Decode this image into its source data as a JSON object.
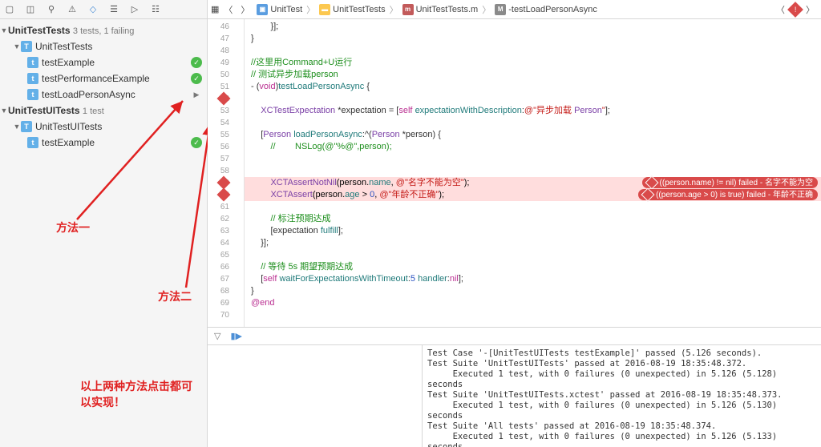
{
  "navigator": {
    "groups": [
      {
        "name": "UnitTestTests",
        "info": "3 tests, 1 failing",
        "children": [
          {
            "name": "UnitTestTests",
            "type": "class",
            "children": [
              {
                "name": "testExample",
                "status": "pass"
              },
              {
                "name": "testPerformanceExample",
                "status": "pass"
              },
              {
                "name": "testLoadPersonAsync",
                "status": "run"
              }
            ]
          }
        ]
      },
      {
        "name": "UnitTestUITests",
        "info": "1 test",
        "children": [
          {
            "name": "UnitTestUITests",
            "type": "class",
            "children": [
              {
                "name": "testExample",
                "status": "pass"
              }
            ]
          }
        ]
      }
    ]
  },
  "breadcrumb": {
    "items": [
      {
        "icon": "bc-blue",
        "label": "UnitTest"
      },
      {
        "icon": "bc-folder",
        "label": "UnitTestTests"
      },
      {
        "icon": "bc-m",
        "label": "UnitTestTests.m"
      },
      {
        "icon": "bc-grey",
        "iconText": "M",
        "label": "-testLoadPersonAsync"
      }
    ]
  },
  "gutter": {
    "start": 46,
    "end": 70,
    "errors": [
      52,
      59,
      60
    ]
  },
  "code": {
    "46": "        }];",
    "47": "}",
    "48": "",
    "49": "//这里用Command+U运行",
    "50": "// 测试异步加载person",
    "51": "- (void)testLoadPersonAsync {",
    "52": "",
    "53": "    XCTestExpectation *expectation = [self expectationWithDescription:@\"异步加载 Person\"];",
    "54": "",
    "55": "    [Person loadPersonAsync:^(Person *person) {",
    "56": "        //        NSLog(@\"%@\",person);",
    "57": "",
    "58": "",
    "59": "        XCTAssertNotNil(person.name, @\"名字不能为空\");",
    "60": "        XCTAssert(person.age > 0, @\"年龄不正确\");",
    "61": "",
    "62": "        // 标注预期达成",
    "63": "        [expectation fulfill];",
    "64": "    }];",
    "65": "",
    "66": "    // 等待 5s 期望预期达成",
    "67": "    [self waitForExpectationsWithTimeout:5 handler:nil];",
    "68": "}",
    "69": "@end",
    "70": ""
  },
  "errors": {
    "59": "((person.name) != nil) failed - 名字不能为空",
    "60": "((person.age > 0) is true) failed - 年龄不正确"
  },
  "console": {
    "text": "Test Case '-[UnitTestUITests testExample]' passed (5.126 seconds).\nTest Suite 'UnitTestUITests' passed at 2016-08-19 18:35:48.372.\n     Executed 1 test, with 0 failures (0 unexpected) in 5.126 (5.128) seconds\nTest Suite 'UnitTestUITests.xctest' passed at 2016-08-19 18:35:48.373.\n     Executed 1 test, with 0 failures (0 unexpected) in 5.126 (5.130) seconds\nTest Suite 'All tests' passed at 2016-08-19 18:35:48.374.\n     Executed 1 test, with 0 failures (0 unexpected) in 5.126 (5.133) seconds"
  },
  "annotations": {
    "method1": "方法一",
    "method2": "方法二",
    "footer": "以上两种方法点击都可\n以实现！"
  }
}
